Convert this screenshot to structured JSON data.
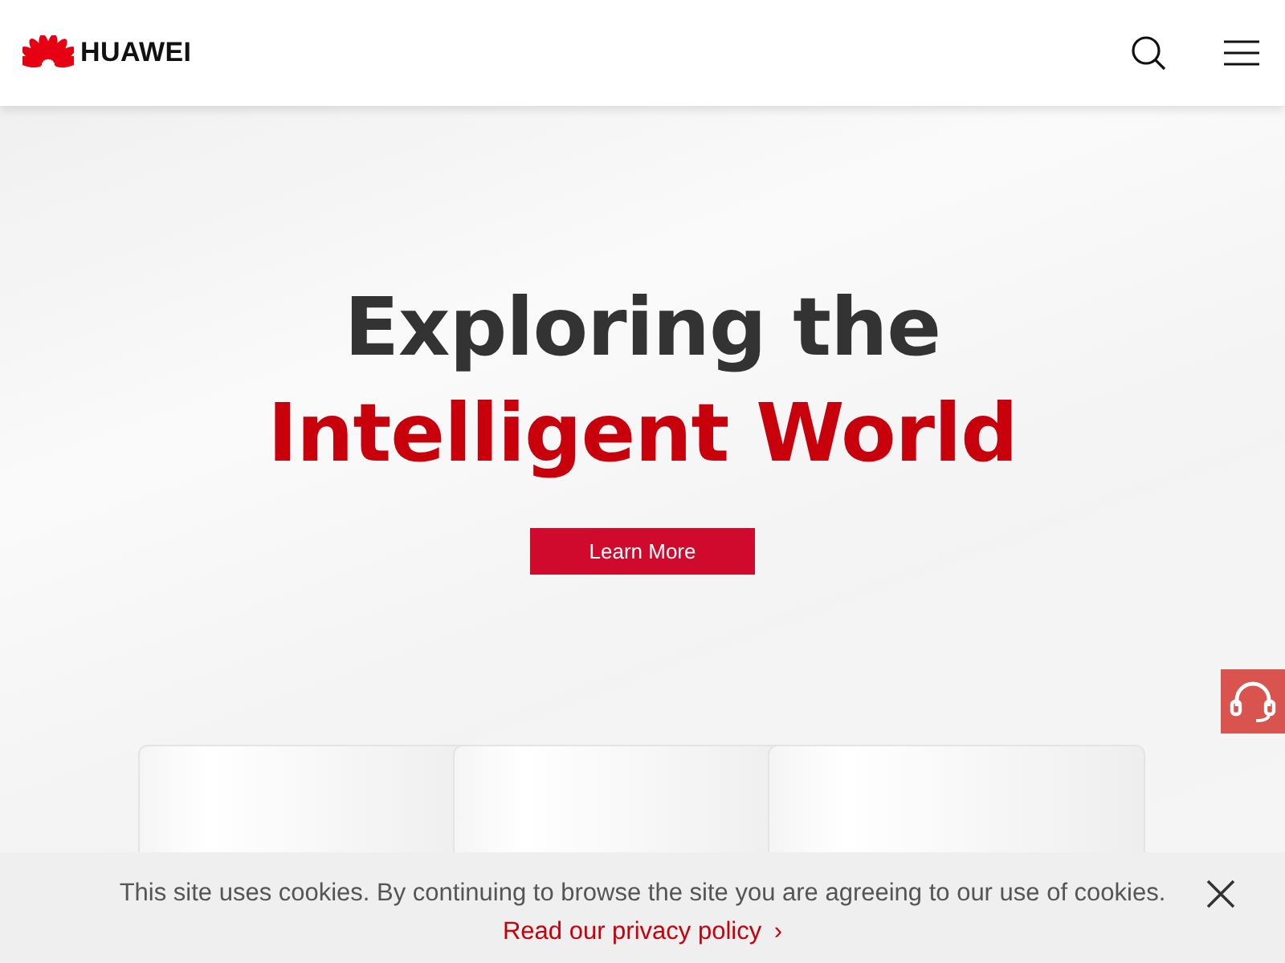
{
  "header": {
    "brand": "HUAWEI"
  },
  "hero": {
    "title_line_1": "Exploring the",
    "title_line_2": "Intelligent World",
    "button": "Learn More"
  },
  "cookie_bar": {
    "message": "This site uses cookies. By continuing to browse the site you are agreeing to our use of cookies.",
    "link": "Read our privacy policy",
    "link_arrow": "›"
  }
}
